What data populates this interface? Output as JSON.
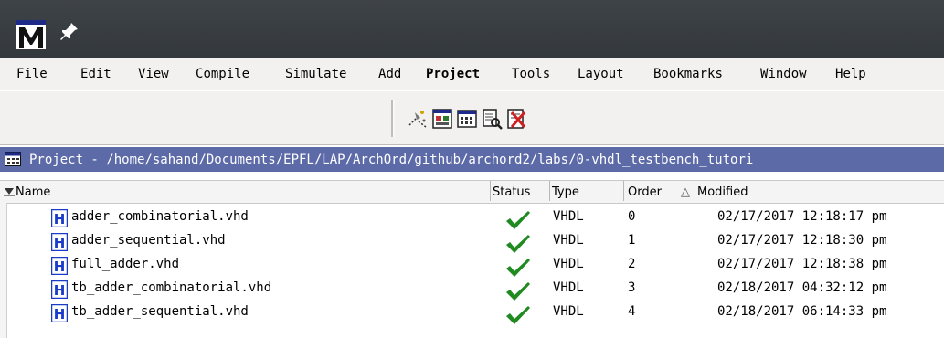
{
  "menu": {
    "items": [
      {
        "pre": "",
        "ul": "F",
        "post": "ile",
        "bold": false
      },
      {
        "pre": "",
        "ul": "E",
        "post": "dit",
        "bold": false
      },
      {
        "pre": "",
        "ul": "V",
        "post": "iew",
        "bold": false
      },
      {
        "pre": "",
        "ul": "C",
        "post": "ompile",
        "bold": false
      },
      {
        "pre": "",
        "ul": "S",
        "post": "imulate",
        "bold": false
      },
      {
        "pre": "A",
        "ul": "d",
        "post": "d",
        "bold": false
      },
      {
        "pre": "",
        "ul": "",
        "post": "Project",
        "bold": true
      },
      {
        "pre": "T",
        "ul": "o",
        "post": "ols",
        "bold": false
      },
      {
        "pre": "Layo",
        "ul": "u",
        "post": "t",
        "bold": false
      },
      {
        "pre": "Boo",
        "ul": "k",
        "post": "marks",
        "bold": false
      },
      {
        "pre": "",
        "ul": "W",
        "post": "indow",
        "bold": false
      },
      {
        "pre": "",
        "ul": "H",
        "post": "elp",
        "bold": false
      }
    ]
  },
  "toolbar": {
    "icons": [
      "compile-icon",
      "compile-out-of-date-icon",
      "compile-all-icon",
      "compile-report-icon",
      "remove-icon"
    ]
  },
  "project": {
    "title": "Project - /home/sahand/Documents/EPFL/LAP/ArchOrd/github/archord2/labs/0-vhdl_testbench_tutori"
  },
  "columns": {
    "name": "Name",
    "status": "Status",
    "type": "Type",
    "order": "Order",
    "sort_indicator": "△",
    "modified": "Modified"
  },
  "files": [
    {
      "name": "adder_combinatorial.vhd",
      "type": "VHDL",
      "order": "0",
      "modified": "02/17/2017 12:18:17 pm",
      "status": "compiled"
    },
    {
      "name": "adder_sequential.vhd",
      "type": "VHDL",
      "order": "1",
      "modified": "02/17/2017 12:18:30 pm",
      "status": "compiled"
    },
    {
      "name": "full_adder.vhd",
      "type": "VHDL",
      "order": "2",
      "modified": "02/17/2017 12:18:38 pm",
      "status": "compiled"
    },
    {
      "name": "tb_adder_combinatorial.vhd",
      "type": "VHDL",
      "order": "3",
      "modified": "02/18/2017 04:32:12 pm",
      "status": "compiled"
    },
    {
      "name": "tb_adder_sequential.vhd",
      "type": "VHDL",
      "order": "4",
      "modified": "02/18/2017 06:14:33 pm",
      "status": "compiled"
    }
  ],
  "colors": {
    "project_bar": "#5d6aa8",
    "check": "#1f8a1f",
    "file_icon": "#1a3cc8"
  }
}
